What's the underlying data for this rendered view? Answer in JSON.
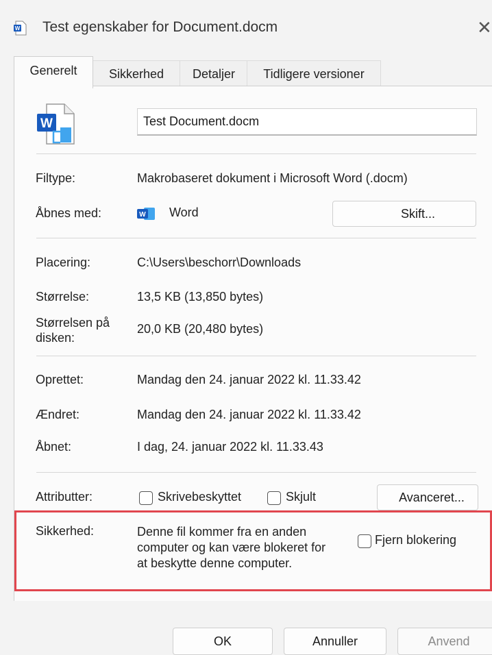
{
  "window": {
    "title": "Test egenskaber for Document.docm",
    "close_glyph": "✕"
  },
  "tabs": [
    {
      "label": "Generelt"
    },
    {
      "label": "Sikkerhed"
    },
    {
      "label": "Detaljer"
    },
    {
      "label": "Tidligere versioner"
    }
  ],
  "file": {
    "name": "Test Document.docm",
    "icon_letter": "W"
  },
  "rows": {
    "filtype": {
      "label": "Filtype:",
      "value": "Makrobaseret dokument i Microsoft Word (.docm)"
    },
    "abnes_med": {
      "label": "Åbnes med:",
      "app": "Word",
      "icon_letter": "W",
      "button": "Skift..."
    },
    "placering": {
      "label": "Placering:",
      "value": "C:\\Users\\beschorr\\Downloads"
    },
    "storrelse": {
      "label": "Størrelse:",
      "value": "13,5 KB (13,850 bytes)"
    },
    "storrelse_disk": {
      "label_line1": "Størrelsen på",
      "label_line2": "disken:",
      "value": "20,0 KB (20,480 bytes)"
    },
    "oprettet": {
      "label": "Oprettet:",
      "value": "Mandag den 24. januar 2022 kl. 11.33.42"
    },
    "aendret": {
      "label": "Ændret:",
      "value": "Mandag den 24. januar 2022 kl. 11.33.42"
    },
    "abnet": {
      "label": "Åbnet:",
      "value": "I dag, 24. januar 2022 kl. 11.33.43"
    },
    "attributter": {
      "label": "Attributter:",
      "readonly_label": "Skrivebeskyttet",
      "readonly_checked": false,
      "hidden_label": "Skjult",
      "hidden_checked": false,
      "advanced_button": "Avanceret..."
    },
    "sikkerhed": {
      "label": "Sikkerhed:",
      "text_line1": "Denne fil kommer fra en anden",
      "text_line2": "computer og kan være blokeret for",
      "text_line3": "at beskytte denne computer.",
      "unblock_label": "Fjern blokering",
      "unblock_checked": false,
      "highlight_color": "#e1464e"
    }
  },
  "buttons": {
    "ok": "OK",
    "cancel": "Annuller",
    "apply": "Anvend"
  },
  "colors": {
    "word_blue": "#185abd",
    "word_blue_light": "#41a5ee"
  }
}
